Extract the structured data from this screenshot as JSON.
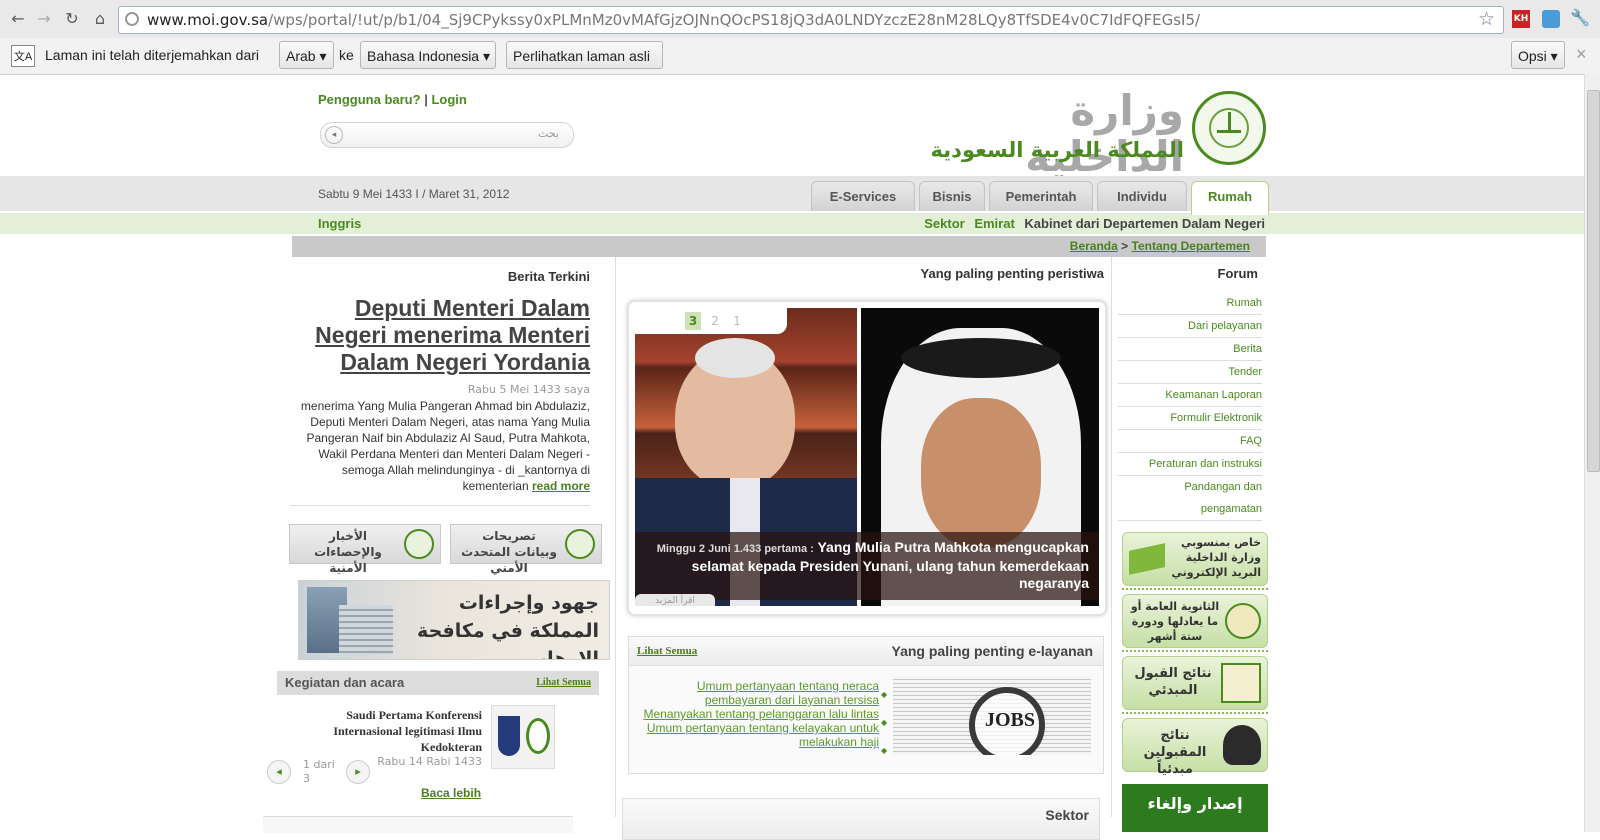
{
  "browser": {
    "url_host": "www.moi.gov.sa",
    "url_path": "/wps/portal/!ut/p/b1/04_Sj9CPykssy0xPLMnMz0vMAfGjzOJNnQOcPS18jQ3dA0LNDYzczE28nM28LQy8TfSDE4v0C7IdFQFEGsI5/"
  },
  "translate_bar": {
    "message": "Laman ini telah diterjemahkan dari",
    "from_lang": "Arab",
    "to_word": "ke",
    "to_lang": "Bahasa Indonesia",
    "show_original": "Perlihatkan laman asli",
    "options": "Opsi",
    "close": "×"
  },
  "header": {
    "new_user": "Pengguna baru?",
    "separator": "|",
    "login": "Login",
    "search_placeholder": "بحث",
    "logo_line1": "وزارة الداخلية",
    "logo_line2": "المملكة العربية السعودية"
  },
  "nav": {
    "date": "Sabtu 9 Mei 1433 I / Maret 31, 2012",
    "tabs": [
      "E-Services",
      "Bisnis",
      "Pemerintah",
      "Individu",
      "Rumah"
    ],
    "english": "Inggris",
    "sector": "Sektor",
    "emirates": "Emirat",
    "cabinet": "Kabinet dari Departemen Dalam Negeri",
    "breadcrumb_home": "Beranda",
    "breadcrumb_sep": ">",
    "breadcrumb_current": "Tentang Departemen"
  },
  "latest_news": {
    "heading": "Berita Terkini",
    "title": "Deputi Menteri Dalam Negeri menerima Menteri Dalam Negeri Yordania",
    "date": "Rabu 5 Mei 1433 saya",
    "body": "menerima Yang Mulia Pangeran Ahmad bin Abdulaziz, Deputi Menteri Dalam Negeri, atas nama Yang Mulia Pangeran Naif bin Abdulaziz Al Saud, Putra Mahkota, Wakil Perdana Menteri dan Menteri Dalam Negeri - semoga Allah melindunginya - di _kantornya di kementerian",
    "read_more": "read more"
  },
  "promo": {
    "btn1": "الأخبار والإحصاءات الأمنية",
    "btn2": "تصريحات وبيانات المتحدث الأمني",
    "banner": "جهود وإجراءات المملكة في مكافحة الإرهاب"
  },
  "events": {
    "heading": "Kegiatan dan acara",
    "see_all": "Lihat Semua",
    "item_title": "Saudi Pertama Konferensi Internasional legitimasi Ilmu Kedokteran",
    "item_date": "Rabu 14 Rabi 1433",
    "pager": "1 dari 3",
    "read_more": "Baca lebih"
  },
  "important_events": {
    "heading": "Yang paling penting peristiwa",
    "pages": [
      "3",
      "2",
      "1"
    ],
    "caption_date": "Minggu 2 Juni 1.433 pertama :",
    "caption_title": "Yang Mulia Putra Mahkota mengucapkan selamat kepada Presiden Yunani, ulang tahun kemerdekaan negaranya",
    "more_btn": "اقرأ المزيد"
  },
  "eservices": {
    "heading": "Yang paling penting e-layanan",
    "see_all": "Lihat Semua",
    "links": [
      "Umum pertanyaan tentang neraca pembayaran dari layanan tersisa",
      "Menanyakan tentang pelanggaran lalu lintas",
      "Umum pertanyaan tentang kelayakan untuk melakukan haji"
    ],
    "image_text": "JOBS"
  },
  "sector_box": {
    "heading": "Sektor"
  },
  "forum": {
    "heading": "Forum",
    "items": [
      "Rumah",
      "Dari pelayanan",
      "Berita",
      "Tender",
      "Keamanan Laporan",
      "Formulir Elektronik",
      "FAQ",
      "Peraturan dan instruksi",
      "Pandangan dan",
      "pengamatan"
    ]
  },
  "side_badges": [
    "خاص بمنسوبي وزارة الداخلية البريد الإلكتروني",
    "الثانوية العامة أو ما يعادلها ودورة ستة أشهر",
    "نتائج القبول المبدئي",
    "نتائج المقبولين مبدئياً",
    "إصدار وإلغاء"
  ],
  "colors": {
    "accent_green": "#4a8a1e",
    "band_green": "#e3f0d7",
    "band_gray": "#e6e6e6"
  }
}
